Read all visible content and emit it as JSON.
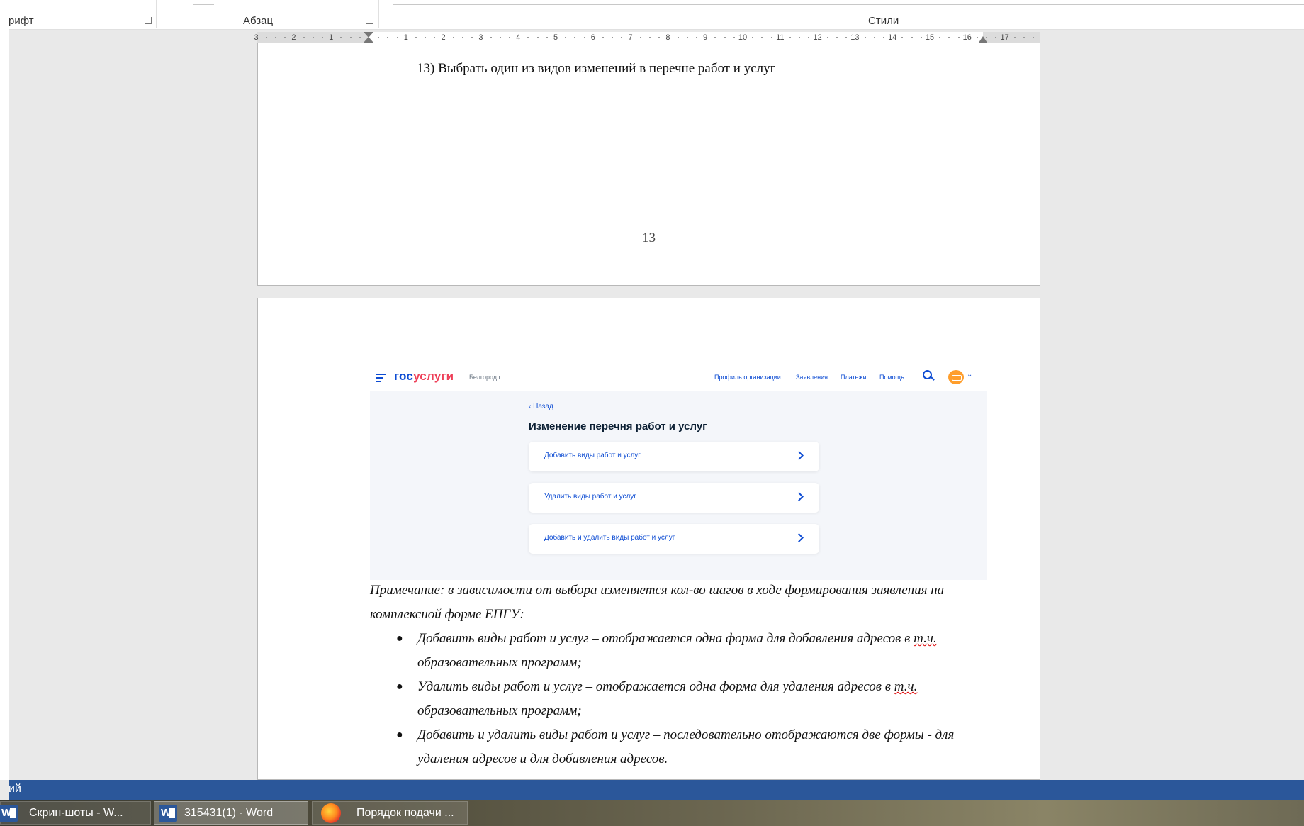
{
  "ribbon": {
    "groups": [
      {
        "label": "рифт"
      },
      {
        "label": "Абзац"
      },
      {
        "label": "Стили"
      }
    ]
  },
  "ruler": {
    "left_labels": [
      "3",
      "2",
      "1"
    ],
    "right_labels": [
      "1",
      "2",
      "3",
      "4",
      "5",
      "6",
      "7",
      "8",
      "9",
      "10",
      "11",
      "12",
      "13",
      "14",
      "15",
      "16",
      "17"
    ]
  },
  "page1": {
    "step_heading": "13) Выбрать один из видов изменений в перечне работ и услуг",
    "page_number": "13"
  },
  "screenshot": {
    "logo_part1": "гос",
    "logo_part2": "услуги",
    "region": "Белгород г",
    "nav": [
      "Профиль организации",
      "Заявления",
      "Платежи",
      "Помощь"
    ],
    "back_label": "Назад",
    "title": "Изменение перечня работ и услуг",
    "options": [
      "Добавить виды работ и услуг",
      "Удалить виды работ и услуг",
      "Добавить и удалить виды работ и услуг"
    ]
  },
  "note": {
    "intro": "Примечание: в зависимости от выбора изменяется кол-во шагов в ходе формирования заявления на комплексной форме ЕПГУ:",
    "bullets": [
      {
        "before": "Добавить виды работ и услуг – отображается одна форма для добавления адресов в ",
        "abbr": "т.ч.",
        "after": " образовательных программ;"
      },
      {
        "before": "Удалить виды работ и услуг – отображается одна форма для удаления адресов в ",
        "abbr": "т.ч.",
        "after": " образовательных программ;"
      },
      {
        "text": "Добавить и удалить виды работ и услуг – последовательно отображаются две формы - для удаления адресов и для добавления адресов."
      }
    ]
  },
  "statusbar": {
    "text": "ий"
  },
  "taskbar": {
    "items": [
      {
        "label": "Скрин-шоты - W...",
        "icon": "word-icon"
      },
      {
        "label": "315431(1) - Word",
        "icon": "word-icon"
      },
      {
        "label": "Порядок подачи ...",
        "icon": "firefox-icon"
      }
    ]
  },
  "colors": {
    "gosuslugi_blue": "#0d4cd3",
    "gosuslugi_red": "#ee3f58",
    "word_blue": "#2b579a"
  }
}
